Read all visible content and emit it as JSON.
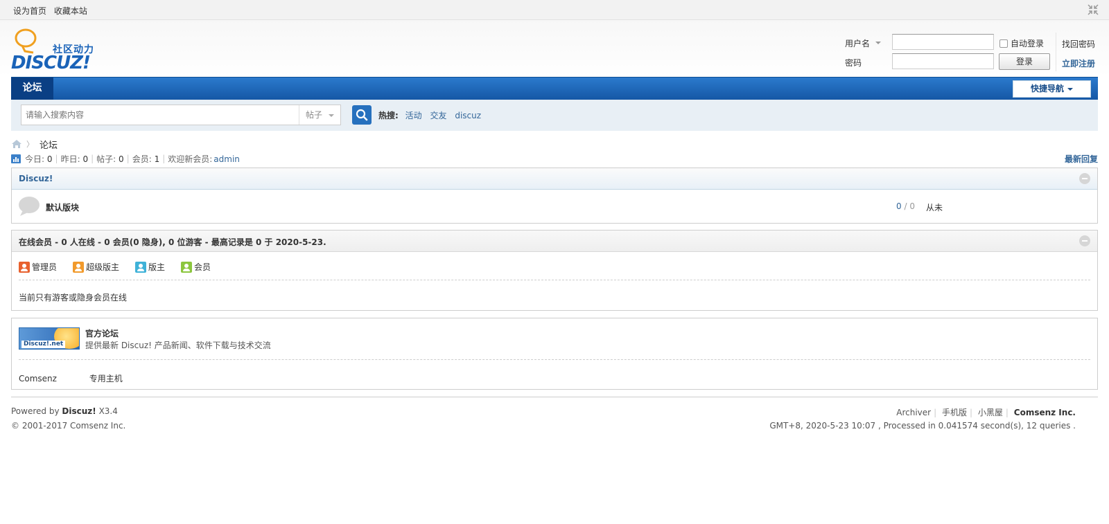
{
  "topbar": {
    "links": [
      "设为首页",
      "收藏本站"
    ]
  },
  "header": {
    "logo_cn": "社区动力",
    "logo_word": "DISCUZ!",
    "login": {
      "username_label": "用户名",
      "password_label": "密码",
      "username_value": "",
      "password_value": "",
      "auto_login_label": "自动登录",
      "login_button": "登录",
      "forgot_password": "找回密码",
      "register": "立即注册"
    }
  },
  "nav": {
    "active_tab": "论坛",
    "quick_nav": "快捷导航"
  },
  "search": {
    "placeholder": "请输入搜索内容",
    "type_selected": "帖子",
    "hot_label": "热搜:",
    "hot_terms": [
      "活动",
      "交友",
      "discuz"
    ]
  },
  "breadcrumb": {
    "current": "论坛"
  },
  "stats": {
    "today_label": "今日:",
    "today_value": "0",
    "yesterday_label": "昨日:",
    "yesterday_value": "0",
    "posts_label": "帖子:",
    "posts_value": "0",
    "members_label": "会员:",
    "members_value": "1",
    "welcome_label": "欢迎新会员:",
    "newest_member": "admin",
    "latest_replies": "最新回复"
  },
  "category": {
    "title": "Discuz!",
    "forums": [
      {
        "name": "默认版块",
        "threads": "0",
        "posts": "0",
        "last_post": "从未"
      }
    ]
  },
  "online": {
    "title": "在线会员 - 0 人在线 - 0 会员(0 隐身), 0 位游客 - 最高记录是 0 于 2020-5-23.",
    "legend": [
      {
        "label": "管理员",
        "color": "#e8612e"
      },
      {
        "label": "超级版主",
        "color": "#f19a2c"
      },
      {
        "label": "版主",
        "color": "#3fb2d8"
      },
      {
        "label": "会员",
        "color": "#8cc63f"
      }
    ],
    "message": "当前只有游客或隐身会员在线"
  },
  "links_box": {
    "banner_label": "Discuz!.net",
    "name": "官方论坛",
    "description": "提供最新 Discuz! 产品新闻、软件下载与技术交流",
    "text_links": [
      "Comsenz",
      "专用主机"
    ]
  },
  "footer": {
    "powered_by": "Powered by",
    "product": "Discuz!",
    "version": "X3.4",
    "copyright": "© 2001-2017 Comsenz Inc.",
    "right_links": [
      "Archiver",
      "手机版",
      "小黑屋"
    ],
    "company": "Comsenz Inc.",
    "processed": "GMT+8, 2020-5-23 10:07 , Processed in 0.041574 second(s), 12 queries ."
  }
}
